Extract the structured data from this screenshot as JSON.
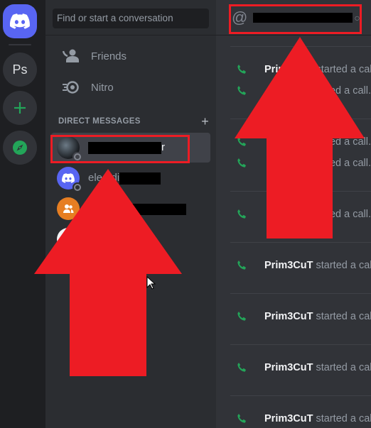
{
  "server_rail": {
    "home_icon": "discord-logo-icon",
    "servers": [
      {
        "label": "Ps",
        "name": "server-ps"
      }
    ],
    "add_server_icon": "plus-icon",
    "explore_icon": "compass-icon",
    "add_label": "+",
    "accent_color": "#5865f2",
    "green_color": "#23a559"
  },
  "sidebar": {
    "search": {
      "placeholder": "Find or start a conversation"
    },
    "nav": [
      {
        "label": "Friends",
        "icon": "friends-icon"
      },
      {
        "label": "Nitro",
        "icon": "nitro-icon"
      }
    ],
    "dm_header": {
      "label": "DIRECT MESSAGES",
      "add_label": "+"
    },
    "direct_messages": [
      {
        "name_visible": "r",
        "redacted": true,
        "active": true,
        "status": "offline"
      },
      {
        "name_visible": "ele",
        "name_visible_2": "di",
        "redacted": true,
        "status": "offline"
      },
      {
        "name_visible": "",
        "redacted": true,
        "group": true
      }
    ]
  },
  "main": {
    "header": {
      "icon": "at-sign-icon",
      "title_redacted": true
    },
    "messages": [
      {
        "author": "Prim3CuT",
        "text": "started a call."
      },
      {
        "author": "",
        "text": "started a call."
      },
      {
        "author": "",
        "text": "started a call."
      },
      {
        "author": "",
        "text": "started a call."
      },
      {
        "author": "",
        "text": "started a call."
      },
      {
        "author": "Prim3CuT",
        "text": "started a call."
      },
      {
        "author": "Prim3CuT",
        "text": "started a call."
      },
      {
        "author": "Prim3CuT",
        "text": "started a call."
      },
      {
        "author": "Prim3CuT",
        "text": "started a call."
      }
    ]
  },
  "annotations": {
    "color": "#ed1c24"
  }
}
